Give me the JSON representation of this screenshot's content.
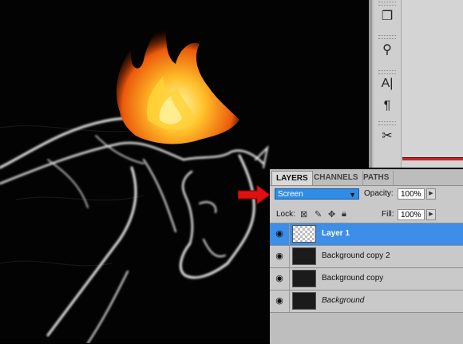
{
  "artwork": {
    "description_label": ""
  },
  "tools": [
    {
      "icon": "history-brush-icon",
      "glyph": "❐"
    },
    {
      "icon": "3d-object-icon",
      "glyph": "⚲"
    },
    {
      "icon": "character-icon",
      "glyph": "A|"
    },
    {
      "icon": "paragraph-icon",
      "glyph": "¶"
    },
    {
      "icon": "tool-presets-icon",
      "glyph": "✂"
    }
  ],
  "layers_panel": {
    "tabs": [
      "LAYERS",
      "CHANNELS",
      "PATHS"
    ],
    "active_tab": "LAYERS",
    "blend_mode": "Screen",
    "opacity_label": "Opacity:",
    "opacity_value": "100%",
    "lock_label": "Lock:",
    "fill_label": "Fill:",
    "fill_value": "100%",
    "layers": [
      {
        "name": "Layer 1",
        "selected": true,
        "italic": false
      },
      {
        "name": "Background copy 2",
        "selected": false,
        "italic": false
      },
      {
        "name": "Background copy",
        "selected": false,
        "italic": false
      },
      {
        "name": "Background",
        "selected": false,
        "italic": true
      }
    ]
  },
  "colors": {
    "accent": "#3d8ee8",
    "pointer_arrow": "#e01010",
    "flame_core": "#ffd23a",
    "flame_outer": "#e2440a"
  }
}
